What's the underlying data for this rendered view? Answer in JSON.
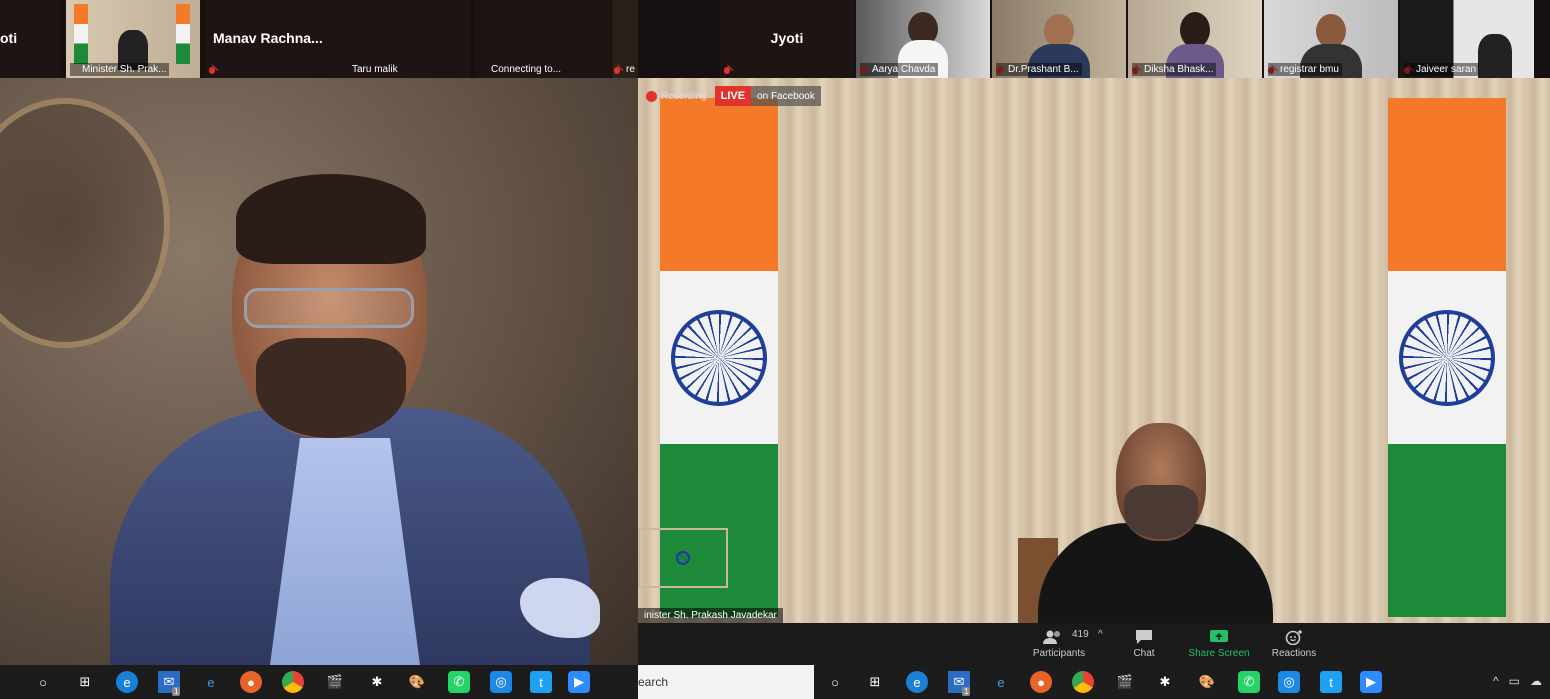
{
  "left_window": {
    "strip": {
      "truncated_name_left": "oti",
      "tile_minister_caption": "Minister Sh. Prak...",
      "tile_manav_name": "Manav Rachna...",
      "tile_taru_caption": "Taru malik",
      "connecting_caption": "Connecting to...",
      "edge_caption": "re"
    }
  },
  "right_window": {
    "strip": {
      "tile_jyoti_name": "Jyoti",
      "tile_aarya_caption": "Aarya Chavda",
      "tile_prashant_caption": "Dr.Prashant B...",
      "tile_diksha_caption": "Diksha Bhask...",
      "tile_registrar_caption": "registrar bmu",
      "tile_jaiveer_caption": "Jaiveer saran"
    },
    "recording": {
      "label": "Recording",
      "live": "LIVE",
      "platform": "on Facebook"
    },
    "speaker_label": "inister Sh. Prakash Javadekar",
    "toolbar": {
      "participants_count": "419",
      "participants_label": "Participants",
      "chat_label": "Chat",
      "share_label": "Share Screen",
      "reactions_label": "Reactions"
    },
    "taskbar_search": "earch"
  },
  "taskbar": {
    "mail_badge": "1"
  },
  "colors": {
    "accent_share": "#22c06a",
    "live_red": "#e0332c",
    "toolbar_bg": "#1a1a1a"
  }
}
